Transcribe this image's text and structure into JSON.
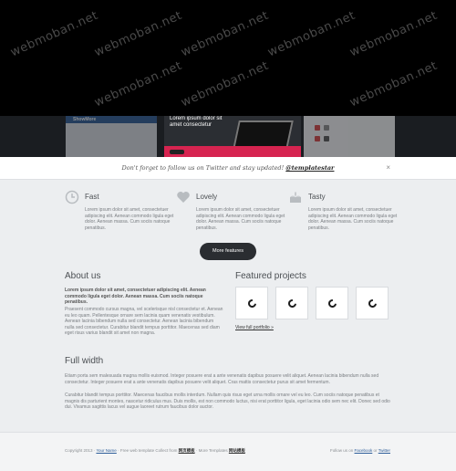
{
  "watermarks": [
    "webmoban.net",
    "webmoban.net",
    "webmoban.net",
    "webmoban.net",
    "webmoban.net",
    "webmoban.net",
    "webmoban.net",
    "webmoban.net"
  ],
  "slider": {
    "left_logo": "ShowMore",
    "center_heading": "Lorem ipsum dolor sit amet consectetur"
  },
  "notice": {
    "text": "Don't forget to follow us on Twitter and stay updated!",
    "handle": "@templatestar",
    "close": "×"
  },
  "features": [
    {
      "title": "Fast",
      "icon": "clock-icon",
      "text": "Lorem ipsum dolor sit amet, consectetuer adipiscing elit. Aenean commodo ligula eget dolor. Aenean massa. Cum sociis natoque penatibus."
    },
    {
      "title": "Lovely",
      "icon": "heart-icon",
      "text": "Lorem ipsum dolor sit amet, consectetuer adipiscing elit. Aenean commodo ligula eget dolor. Aenean massa. Cum sociis natoque penatibus."
    },
    {
      "title": "Tasty",
      "icon": "cake-icon",
      "text": "Lorem ipsum dolor sit amet, consectetuer adipiscing elit. Aenean commodo ligula eget dolor. Aenean massa. Cum sociis natoque penatibus."
    }
  ],
  "more_features": "More features",
  "about": {
    "title": "About us",
    "lead": "Lorem ipsum dolor sit amet, consectetuer adipiscing elit. Aenean commodo ligula eget dolor. Aenean massa. Cum sociis natoque penatibus.",
    "text": "Praesent commodo cursus magna, vel scelerisque nisl consectetur et. Aenean eu leo quam. Pellentesque ornare sem lacinia quam venenatis vestibulum. Aenean lacinia bibendum nulla sed consectetur. Aenean lacinia bibendum nulla sed consectetur. Curabitur blandit tempus porttitor. Maecenas sed diam eget risus varius blandit sit amet non magna."
  },
  "featured": {
    "title": "Featured projects",
    "link": "View full portfolio »"
  },
  "full_width": {
    "title": "Full width",
    "p1": "Etiam porta sem malesuada magna mollis euismod. Integer posuere erat a ante venenatis dapibus posuere velit aliquet. Aenean lacinia bibendum nulla sed consectetur. Integer posuere erat a ante venenatis dapibus posuere velit aliquet. Cras mattis consectetur purus sit amet fermentum.",
    "p2": "Curabitur blandit tempus porttitor. Maecenas faucibus mollis interdum. Nullam quis risus eget urna mollis ornare vel eu leo. Cum sociis natoque penatibus et magnis dis parturient montes, nascetur ridiculus mus. Duis mollis, est non commodo luctus, nisi erat porttitor ligula, eget lacinia odio sem nec elit. Donec sed odio dui. Vivamus sagittis lacus vel augue laoreet rutrum faucibus dolor auctor."
  },
  "footer": {
    "copyright": "Copyright 2013",
    "your_name": "Your Name",
    "rest": "· Free web template Collect from",
    "collect": "网页模板",
    "more": "· More Templates",
    "more_link": "网站模板",
    "follow": "Follow us on",
    "facebook": "Facebook",
    "or": "or",
    "twitter": "Twitter"
  }
}
